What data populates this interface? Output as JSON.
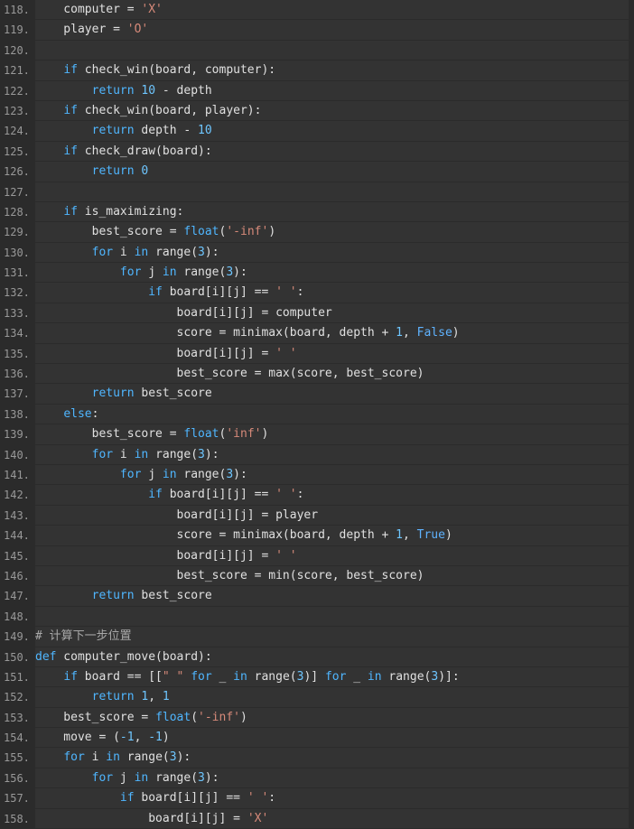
{
  "colors": {
    "background": "#2b2b2b",
    "line_bg": "#333333",
    "line_number": "#999999",
    "text": "#e0e0e0",
    "keyword": "#4fb6ff",
    "function": "#e5d27a",
    "string": "#d78a7a",
    "number": "#6ec6ff",
    "comment": "#a8a8a8"
  },
  "lines": [
    {
      "number": "118.",
      "tokens": [
        {
          "t": "    computer = ",
          "c": "text"
        },
        {
          "t": "'X'",
          "c": "str"
        }
      ]
    },
    {
      "number": "119.",
      "tokens": [
        {
          "t": "    player = ",
          "c": "text"
        },
        {
          "t": "'O'",
          "c": "str"
        }
      ]
    },
    {
      "number": "120.",
      "tokens": [
        {
          "t": "",
          "c": "text"
        }
      ]
    },
    {
      "number": "121.",
      "tokens": [
        {
          "t": "    ",
          "c": "text"
        },
        {
          "t": "if",
          "c": "kw"
        },
        {
          "t": " check_win(board, computer):",
          "c": "text"
        }
      ]
    },
    {
      "number": "122.",
      "tokens": [
        {
          "t": "        ",
          "c": "text"
        },
        {
          "t": "return",
          "c": "kw"
        },
        {
          "t": " ",
          "c": "text"
        },
        {
          "t": "10",
          "c": "num"
        },
        {
          "t": " - depth",
          "c": "text"
        }
      ]
    },
    {
      "number": "123.",
      "tokens": [
        {
          "t": "    ",
          "c": "text"
        },
        {
          "t": "if",
          "c": "kw"
        },
        {
          "t": " check_win(board, player):",
          "c": "text"
        }
      ]
    },
    {
      "number": "124.",
      "tokens": [
        {
          "t": "        ",
          "c": "text"
        },
        {
          "t": "return",
          "c": "kw"
        },
        {
          "t": " depth - ",
          "c": "text"
        },
        {
          "t": "10",
          "c": "num"
        }
      ]
    },
    {
      "number": "125.",
      "tokens": [
        {
          "t": "    ",
          "c": "text"
        },
        {
          "t": "if",
          "c": "kw"
        },
        {
          "t": " check_draw(board):",
          "c": "text"
        }
      ]
    },
    {
      "number": "126.",
      "tokens": [
        {
          "t": "        ",
          "c": "text"
        },
        {
          "t": "return",
          "c": "kw"
        },
        {
          "t": " ",
          "c": "text"
        },
        {
          "t": "0",
          "c": "num"
        }
      ]
    },
    {
      "number": "127.",
      "tokens": [
        {
          "t": "",
          "c": "text"
        }
      ]
    },
    {
      "number": "128.",
      "tokens": [
        {
          "t": "    ",
          "c": "text"
        },
        {
          "t": "if",
          "c": "kw"
        },
        {
          "t": " is_maximizing:",
          "c": "text"
        }
      ]
    },
    {
      "number": "129.",
      "tokens": [
        {
          "t": "        best_score = ",
          "c": "text"
        },
        {
          "t": "float",
          "c": "kw"
        },
        {
          "t": "(",
          "c": "text"
        },
        {
          "t": "'-inf'",
          "c": "str"
        },
        {
          "t": ")",
          "c": "text"
        }
      ]
    },
    {
      "number": "130.",
      "tokens": [
        {
          "t": "        ",
          "c": "text"
        },
        {
          "t": "for",
          "c": "kw"
        },
        {
          "t": " i ",
          "c": "text"
        },
        {
          "t": "in",
          "c": "kw"
        },
        {
          "t": " range(",
          "c": "text"
        },
        {
          "t": "3",
          "c": "num"
        },
        {
          "t": "):",
          "c": "text"
        }
      ]
    },
    {
      "number": "131.",
      "tokens": [
        {
          "t": "            ",
          "c": "text"
        },
        {
          "t": "for",
          "c": "kw"
        },
        {
          "t": " j ",
          "c": "text"
        },
        {
          "t": "in",
          "c": "kw"
        },
        {
          "t": " range(",
          "c": "text"
        },
        {
          "t": "3",
          "c": "num"
        },
        {
          "t": "):",
          "c": "text"
        }
      ]
    },
    {
      "number": "132.",
      "tokens": [
        {
          "t": "                ",
          "c": "text"
        },
        {
          "t": "if",
          "c": "kw"
        },
        {
          "t": " board[i][j] == ",
          "c": "text"
        },
        {
          "t": "' '",
          "c": "str"
        },
        {
          "t": ":",
          "c": "text"
        }
      ]
    },
    {
      "number": "133.",
      "tokens": [
        {
          "t": "                    board[i][j] = computer",
          "c": "text"
        }
      ]
    },
    {
      "number": "134.",
      "tokens": [
        {
          "t": "                    score = minimax(board, depth + ",
          "c": "text"
        },
        {
          "t": "1",
          "c": "num"
        },
        {
          "t": ", ",
          "c": "text"
        },
        {
          "t": "False",
          "c": "const"
        },
        {
          "t": ")",
          "c": "text"
        }
      ]
    },
    {
      "number": "135.",
      "tokens": [
        {
          "t": "                    board[i][j] = ",
          "c": "text"
        },
        {
          "t": "' '",
          "c": "str"
        }
      ]
    },
    {
      "number": "136.",
      "tokens": [
        {
          "t": "                    best_score = max(score, best_score)",
          "c": "text"
        }
      ]
    },
    {
      "number": "137.",
      "tokens": [
        {
          "t": "        ",
          "c": "text"
        },
        {
          "t": "return",
          "c": "kw"
        },
        {
          "t": " best_score",
          "c": "text"
        }
      ]
    },
    {
      "number": "138.",
      "tokens": [
        {
          "t": "    ",
          "c": "text"
        },
        {
          "t": "else",
          "c": "kw"
        },
        {
          "t": ":",
          "c": "text"
        }
      ]
    },
    {
      "number": "139.",
      "tokens": [
        {
          "t": "        best_score = ",
          "c": "text"
        },
        {
          "t": "float",
          "c": "kw"
        },
        {
          "t": "(",
          "c": "text"
        },
        {
          "t": "'inf'",
          "c": "str"
        },
        {
          "t": ")",
          "c": "text"
        }
      ]
    },
    {
      "number": "140.",
      "tokens": [
        {
          "t": "        ",
          "c": "text"
        },
        {
          "t": "for",
          "c": "kw"
        },
        {
          "t": " i ",
          "c": "text"
        },
        {
          "t": "in",
          "c": "kw"
        },
        {
          "t": " range(",
          "c": "text"
        },
        {
          "t": "3",
          "c": "num"
        },
        {
          "t": "):",
          "c": "text"
        }
      ]
    },
    {
      "number": "141.",
      "tokens": [
        {
          "t": "            ",
          "c": "text"
        },
        {
          "t": "for",
          "c": "kw"
        },
        {
          "t": " j ",
          "c": "text"
        },
        {
          "t": "in",
          "c": "kw"
        },
        {
          "t": " range(",
          "c": "text"
        },
        {
          "t": "3",
          "c": "num"
        },
        {
          "t": "):",
          "c": "text"
        }
      ]
    },
    {
      "number": "142.",
      "tokens": [
        {
          "t": "                ",
          "c": "text"
        },
        {
          "t": "if",
          "c": "kw"
        },
        {
          "t": " board[i][j] == ",
          "c": "text"
        },
        {
          "t": "' '",
          "c": "str"
        },
        {
          "t": ":",
          "c": "text"
        }
      ]
    },
    {
      "number": "143.",
      "tokens": [
        {
          "t": "                    board[i][j] = player",
          "c": "text"
        }
      ]
    },
    {
      "number": "144.",
      "tokens": [
        {
          "t": "                    score = minimax(board, depth + ",
          "c": "text"
        },
        {
          "t": "1",
          "c": "num"
        },
        {
          "t": ", ",
          "c": "text"
        },
        {
          "t": "True",
          "c": "const"
        },
        {
          "t": ")",
          "c": "text"
        }
      ]
    },
    {
      "number": "145.",
      "tokens": [
        {
          "t": "                    board[i][j] = ",
          "c": "text"
        },
        {
          "t": "' '",
          "c": "str"
        }
      ]
    },
    {
      "number": "146.",
      "tokens": [
        {
          "t": "                    best_score = min(score, best_score)",
          "c": "text"
        }
      ]
    },
    {
      "number": "147.",
      "tokens": [
        {
          "t": "        ",
          "c": "text"
        },
        {
          "t": "return",
          "c": "kw"
        },
        {
          "t": " best_score",
          "c": "text"
        }
      ]
    },
    {
      "number": "148.",
      "tokens": [
        {
          "t": "",
          "c": "text"
        }
      ]
    },
    {
      "number": "149.",
      "tokens": [
        {
          "t": "# 计算下一步位置",
          "c": "comment"
        }
      ]
    },
    {
      "number": "150.",
      "tokens": [
        {
          "t": "def",
          "c": "kw"
        },
        {
          "t": " computer_move(board):",
          "c": "text"
        }
      ]
    },
    {
      "number": "151.",
      "tokens": [
        {
          "t": "    ",
          "c": "text"
        },
        {
          "t": "if",
          "c": "kw"
        },
        {
          "t": " board == [[",
          "c": "text"
        },
        {
          "t": "\" \"",
          "c": "str"
        },
        {
          "t": " ",
          "c": "text"
        },
        {
          "t": "for",
          "c": "kw"
        },
        {
          "t": " _ ",
          "c": "text"
        },
        {
          "t": "in",
          "c": "kw"
        },
        {
          "t": " range(",
          "c": "text"
        },
        {
          "t": "3",
          "c": "num"
        },
        {
          "t": ")] ",
          "c": "text"
        },
        {
          "t": "for",
          "c": "kw"
        },
        {
          "t": " _ ",
          "c": "text"
        },
        {
          "t": "in",
          "c": "kw"
        },
        {
          "t": " range(",
          "c": "text"
        },
        {
          "t": "3",
          "c": "num"
        },
        {
          "t": ")]:",
          "c": "text"
        }
      ]
    },
    {
      "number": "152.",
      "tokens": [
        {
          "t": "        ",
          "c": "text"
        },
        {
          "t": "return",
          "c": "kw"
        },
        {
          "t": " ",
          "c": "text"
        },
        {
          "t": "1",
          "c": "num"
        },
        {
          "t": ", ",
          "c": "text"
        },
        {
          "t": "1",
          "c": "num"
        }
      ]
    },
    {
      "number": "153.",
      "tokens": [
        {
          "t": "    best_score = ",
          "c": "text"
        },
        {
          "t": "float",
          "c": "kw"
        },
        {
          "t": "(",
          "c": "text"
        },
        {
          "t": "'-inf'",
          "c": "str"
        },
        {
          "t": ")",
          "c": "text"
        }
      ]
    },
    {
      "number": "154.",
      "tokens": [
        {
          "t": "    move = (",
          "c": "text"
        },
        {
          "t": "-1",
          "c": "num"
        },
        {
          "t": ", ",
          "c": "text"
        },
        {
          "t": "-1",
          "c": "num"
        },
        {
          "t": ")",
          "c": "text"
        }
      ]
    },
    {
      "number": "155.",
      "tokens": [
        {
          "t": "    ",
          "c": "text"
        },
        {
          "t": "for",
          "c": "kw"
        },
        {
          "t": " i ",
          "c": "text"
        },
        {
          "t": "in",
          "c": "kw"
        },
        {
          "t": " range(",
          "c": "text"
        },
        {
          "t": "3",
          "c": "num"
        },
        {
          "t": "):",
          "c": "text"
        }
      ]
    },
    {
      "number": "156.",
      "tokens": [
        {
          "t": "        ",
          "c": "text"
        },
        {
          "t": "for",
          "c": "kw"
        },
        {
          "t": " j ",
          "c": "text"
        },
        {
          "t": "in",
          "c": "kw"
        },
        {
          "t": " range(",
          "c": "text"
        },
        {
          "t": "3",
          "c": "num"
        },
        {
          "t": "):",
          "c": "text"
        }
      ]
    },
    {
      "number": "157.",
      "tokens": [
        {
          "t": "            ",
          "c": "text"
        },
        {
          "t": "if",
          "c": "kw"
        },
        {
          "t": " board[i][j] == ",
          "c": "text"
        },
        {
          "t": "' '",
          "c": "str"
        },
        {
          "t": ":",
          "c": "text"
        }
      ]
    },
    {
      "number": "158.",
      "tokens": [
        {
          "t": "                board[i][j] = ",
          "c": "text"
        },
        {
          "t": "'X'",
          "c": "str"
        }
      ]
    }
  ]
}
